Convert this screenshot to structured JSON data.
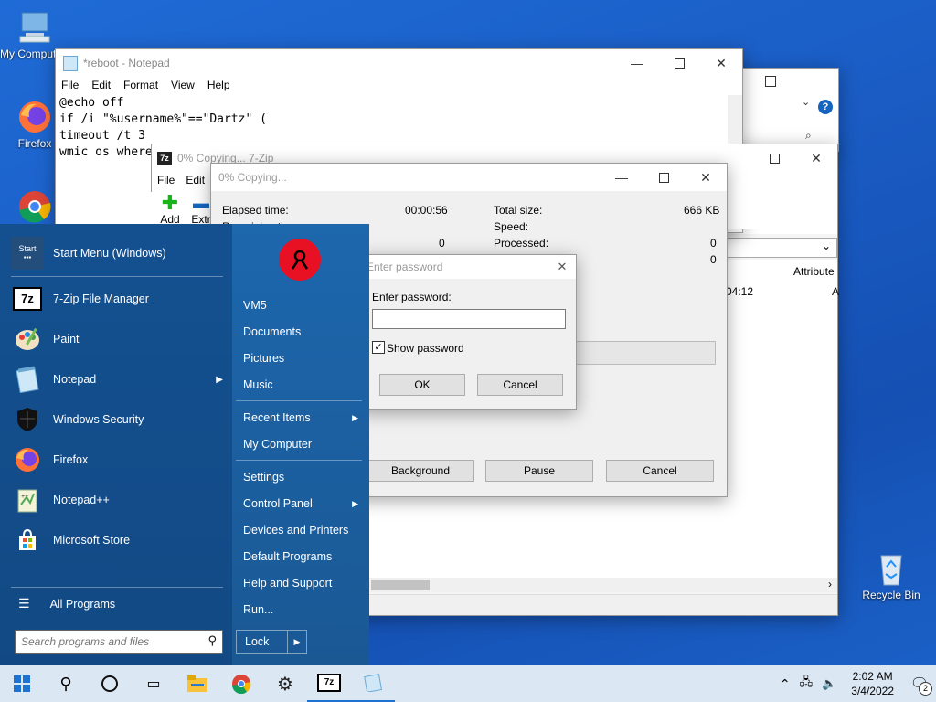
{
  "desktop": {
    "icons": [
      {
        "label": "My Computer"
      },
      {
        "label": "Firefox"
      },
      {
        "label": "Chrome"
      },
      {
        "label": "Recycle Bin"
      }
    ]
  },
  "explorer_back": {
    "ribbon_help": "?"
  },
  "notepad": {
    "title": "*reboot - Notepad",
    "menu": [
      "File",
      "Edit",
      "Format",
      "View",
      "Help"
    ],
    "lines": [
      "@echo off",
      "if /i \"%username%\"==\"Dartz\" (",
      "timeout /t 3",
      "wmic os where"
    ]
  },
  "sevenzip_main": {
    "title": "0% Copying... 7-Zip",
    "menu": [
      "File",
      "Edit"
    ],
    "toolbar": [
      "Add",
      "Extr"
    ],
    "column_attribute": "Attribute",
    "row_time": "04:12",
    "row_attr": "A"
  },
  "copy_dialog": {
    "title": "0% Copying...",
    "elapsed_label": "Elapsed time:",
    "elapsed_value": "00:00:56",
    "remaining_label": "Remaining time:",
    "files_value": "0",
    "total_size_label": "Total size:",
    "total_size_value": "666 KB",
    "speed_label": "Speed:",
    "processed_label": "Processed:",
    "processed_value": "0",
    "compressed_value": "0",
    "background_btn": "Background",
    "pause_btn": "Pause",
    "cancel_btn": "Cancel"
  },
  "password_dialog": {
    "title": "Enter password",
    "label": "Enter password:",
    "value": "",
    "show_password": "Show password",
    "show_checked": true,
    "ok": "OK",
    "cancel": "Cancel"
  },
  "start_menu": {
    "header": "Start Menu (Windows)",
    "apps": [
      "7-Zip File Manager",
      "Paint",
      "Notepad",
      "Windows Security",
      "Firefox",
      "Notepad++",
      "Microsoft Store"
    ],
    "all_programs": "All Programs",
    "search_placeholder": "Search programs and files",
    "right_items_1": [
      "VM5",
      "Documents",
      "Pictures",
      "Music"
    ],
    "right_items_2": [
      "Recent Items",
      "My Computer"
    ],
    "right_items_3": [
      "Settings",
      "Control Panel",
      "Devices and Printers",
      "Default Programs",
      "Help and Support",
      "Run..."
    ],
    "lock": "Lock"
  },
  "taskbar": {
    "time": "2:02 AM",
    "date": "3/4/2022",
    "notifications": "2"
  },
  "colors": {
    "start_blue": "#1b5fa3",
    "taskbar": "#dbe7f3",
    "accent_red": "#e81123"
  }
}
